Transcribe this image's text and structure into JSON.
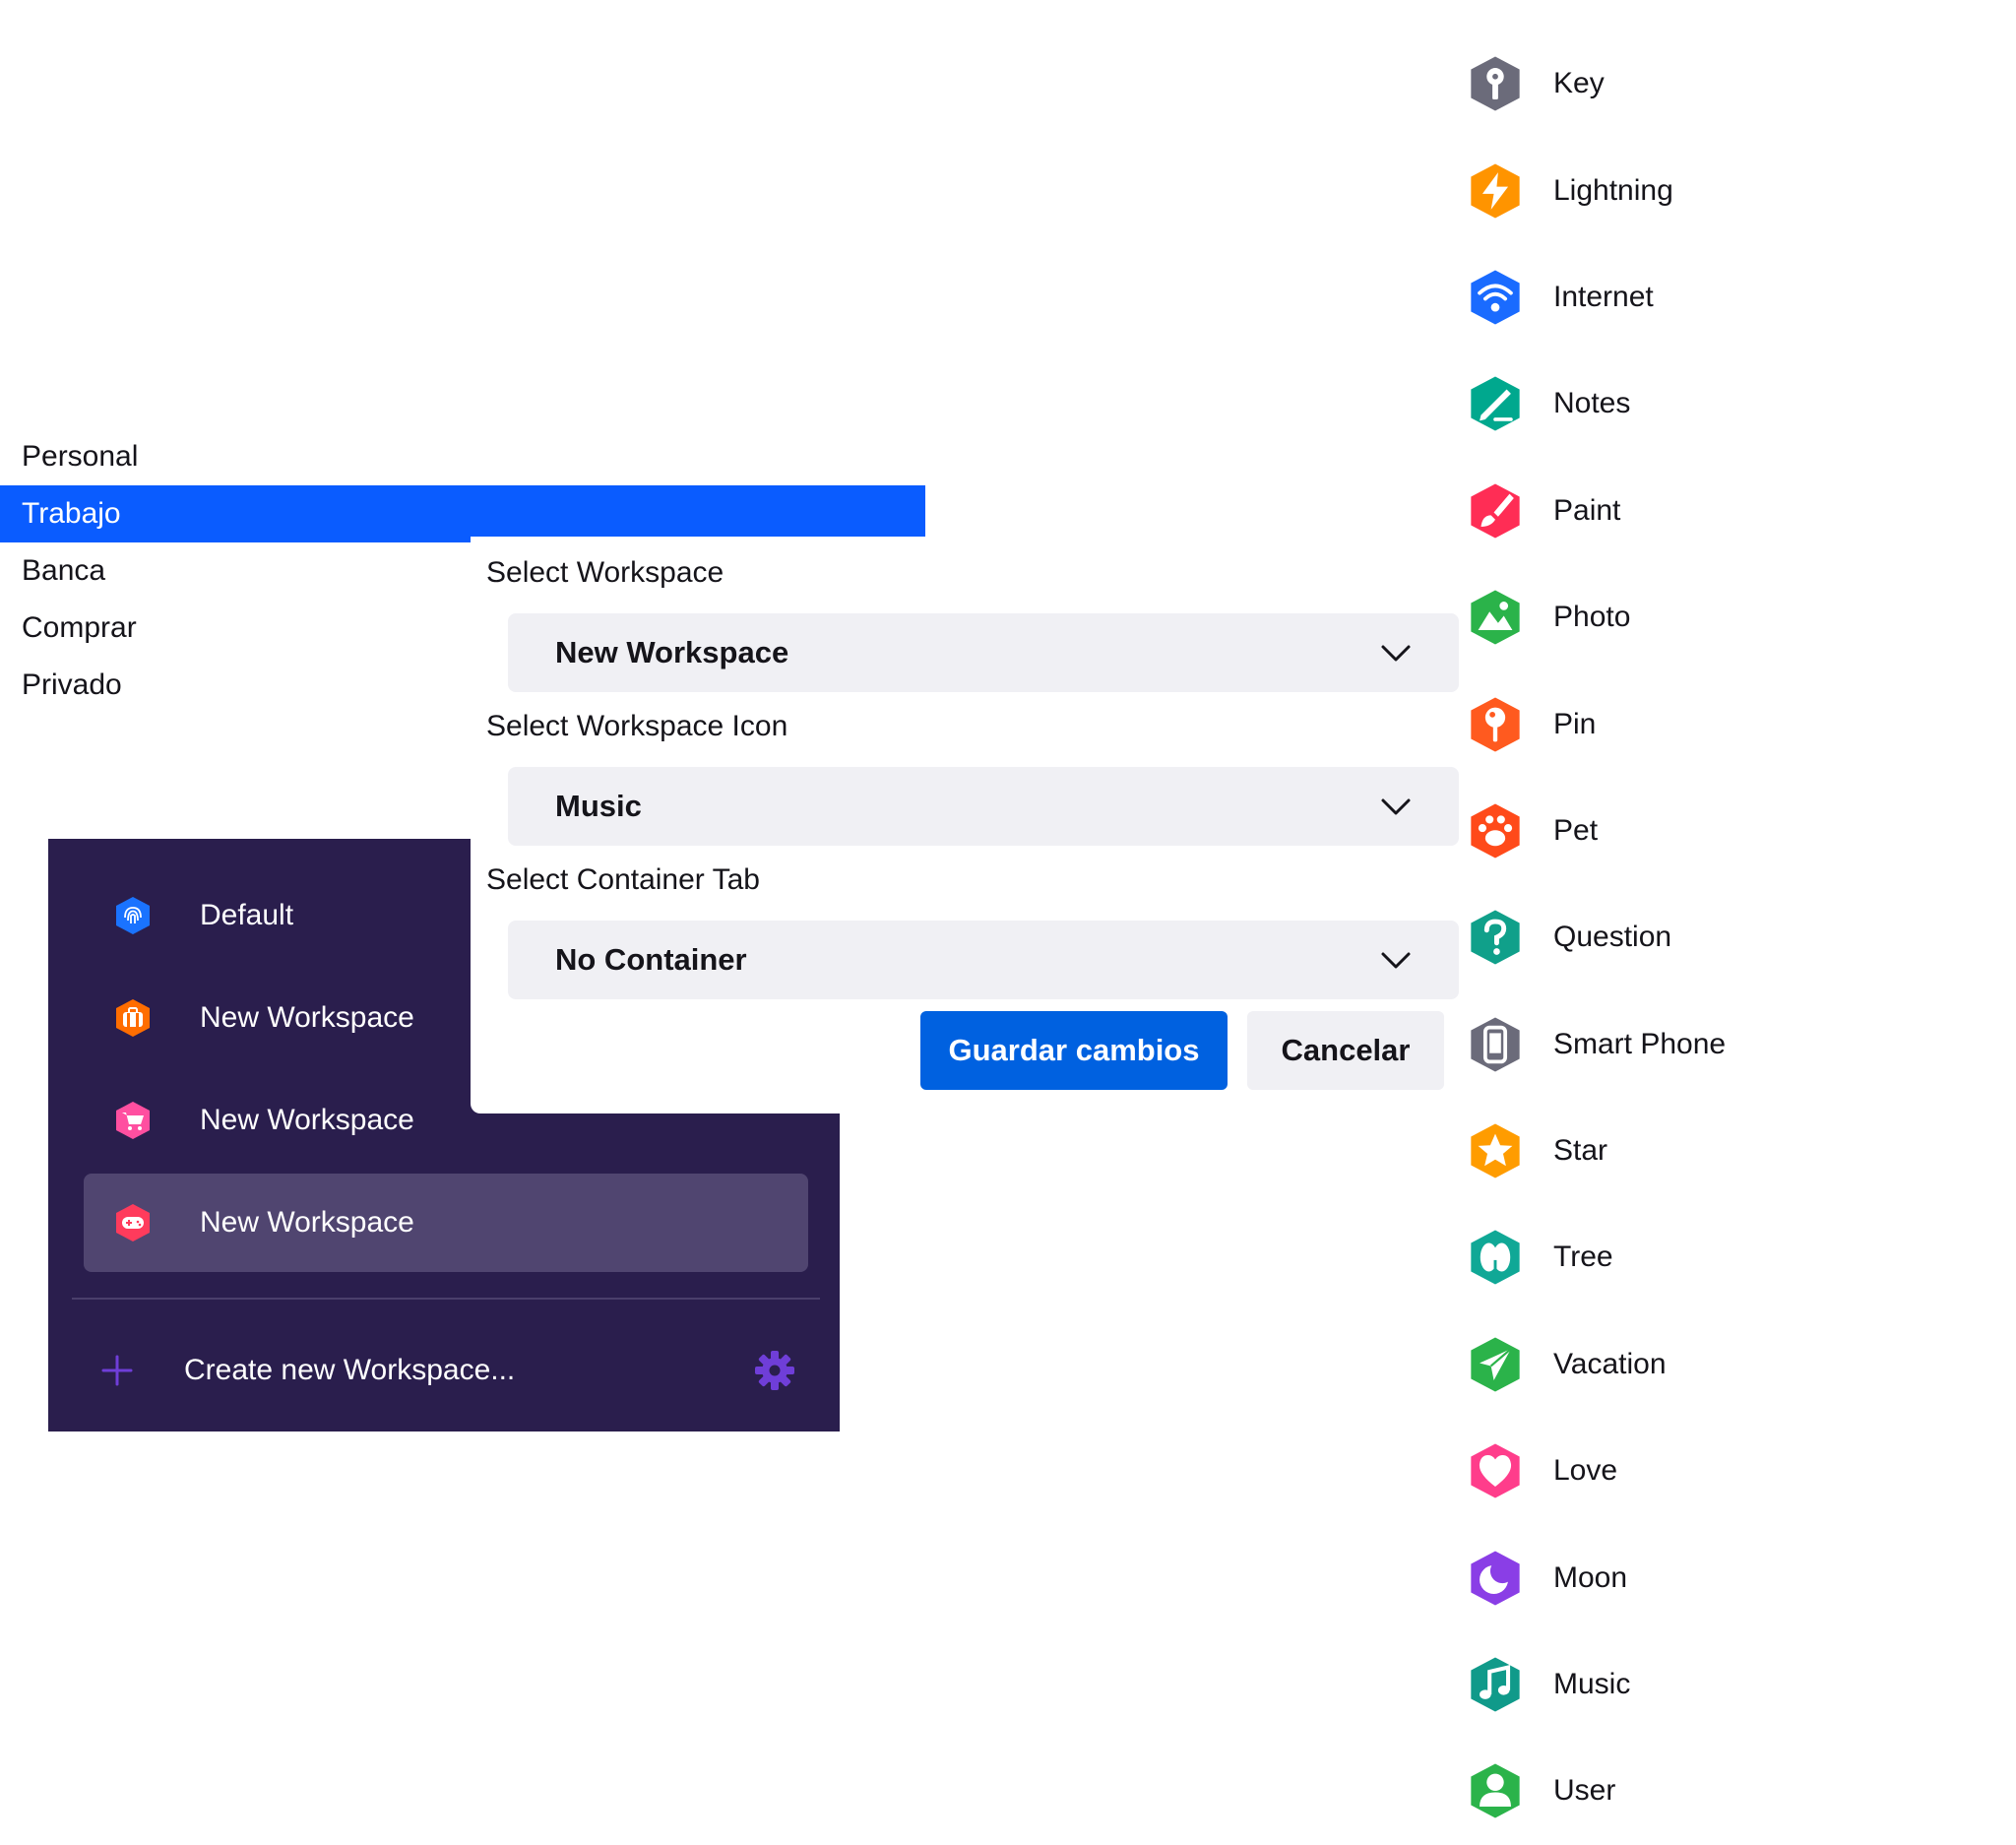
{
  "context_menu": {
    "items": [
      {
        "label": "Personal",
        "selected": false
      },
      {
        "label": "Trabajo",
        "selected": true
      },
      {
        "label": "Banca",
        "selected": false
      },
      {
        "label": "Comprar",
        "selected": false
      },
      {
        "label": "Privado",
        "selected": false
      }
    ]
  },
  "workspaces_panel": {
    "items": [
      {
        "label": "Default",
        "icon": "fingerprint-icon",
        "color": "#1a73ff"
      },
      {
        "label": "New Workspace",
        "icon": "briefcase-icon",
        "color": "#ff6d00"
      },
      {
        "label": "New Workspace",
        "icon": "cart-icon",
        "color": "#ff4fa0"
      },
      {
        "label": "New Workspace",
        "icon": "gamepad-icon",
        "color": "#ff3b5c",
        "active": true
      }
    ],
    "create_label": "Create new Workspace...",
    "accent_color": "#6f3ed8"
  },
  "edit_form": {
    "workspace_label": "Select Workspace",
    "workspace_value": "New Workspace",
    "icon_label": "Select Workspace Icon",
    "icon_value": "Music",
    "container_label": "Select Container Tab",
    "container_value": "No Container",
    "save_label": "Guardar cambios",
    "cancel_label": "Cancelar"
  },
  "icon_list": {
    "items": [
      {
        "label": "Key",
        "icon": "key-icon",
        "color": "#6b6b7a"
      },
      {
        "label": "Lightning",
        "icon": "lightning-icon",
        "color": "#ff9400"
      },
      {
        "label": "Internet",
        "icon": "wifi-icon",
        "color": "#1a6bff"
      },
      {
        "label": "Notes",
        "icon": "notes-icon",
        "color": "#00a88e"
      },
      {
        "label": "Paint",
        "icon": "paint-icon",
        "color": "#ff2d55"
      },
      {
        "label": "Photo",
        "icon": "photo-icon",
        "color": "#2bb34a"
      },
      {
        "label": "Pin",
        "icon": "pin-icon",
        "color": "#ff5a1f"
      },
      {
        "label": "Pet",
        "icon": "pet-icon",
        "color": "#ff4a1a"
      },
      {
        "label": "Question",
        "icon": "question-icon",
        "color": "#10a08a"
      },
      {
        "label": "Smart Phone",
        "icon": "phone-icon",
        "color": "#6b6b7a"
      },
      {
        "label": "Star",
        "icon": "star-icon",
        "color": "#ff9c00"
      },
      {
        "label": "Tree",
        "icon": "tree-icon",
        "color": "#10a896"
      },
      {
        "label": "Vacation",
        "icon": "plane-icon",
        "color": "#2bb34a"
      },
      {
        "label": "Love",
        "icon": "heart-icon",
        "color": "#ff3d8b"
      },
      {
        "label": "Moon",
        "icon": "moon-icon",
        "color": "#8a3ee6"
      },
      {
        "label": "Music",
        "icon": "music-icon",
        "color": "#109a8a"
      },
      {
        "label": "User",
        "icon": "user-icon",
        "color": "#2bb34a"
      }
    ]
  }
}
